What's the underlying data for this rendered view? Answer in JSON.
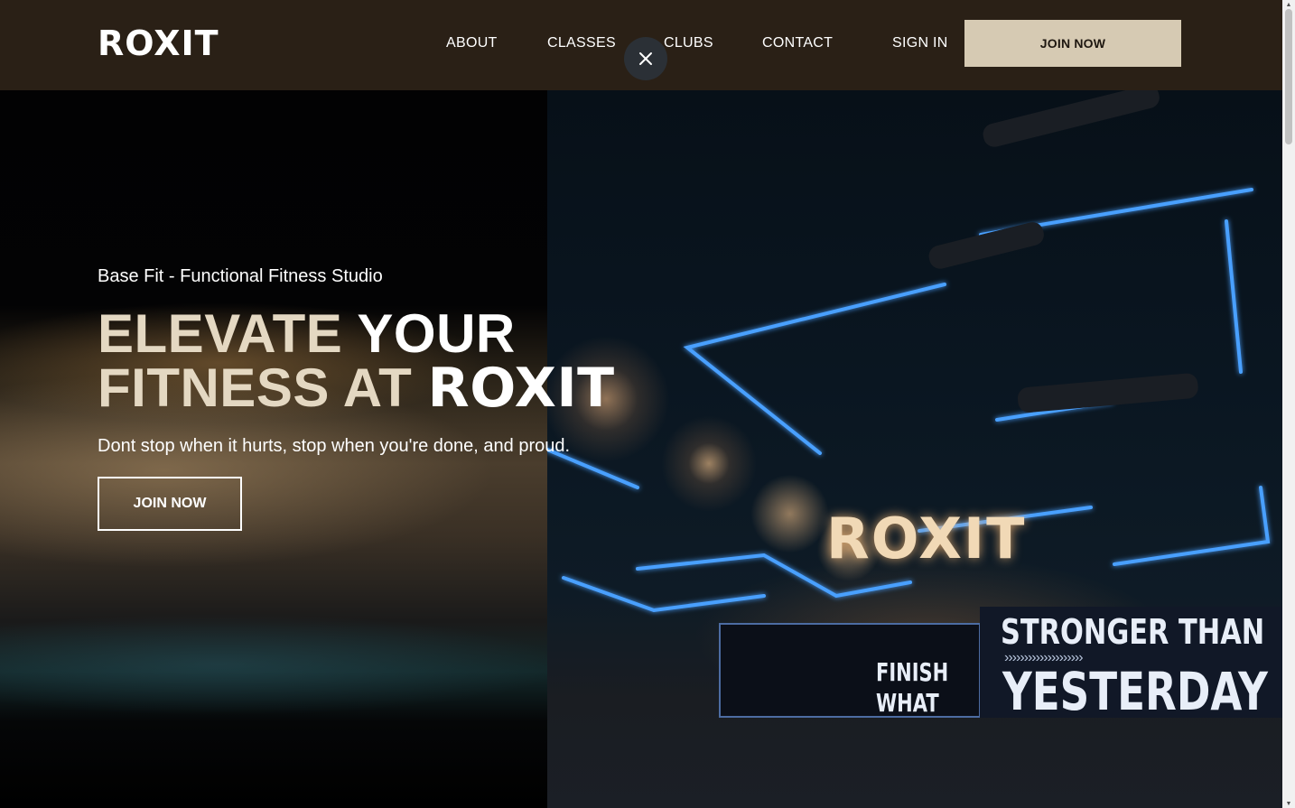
{
  "header": {
    "logo": "ROXIT",
    "nav": {
      "about": "ABOUT",
      "classes": "CLASSES",
      "clubs": "CLUBS",
      "contact": "CONTACT",
      "sign_in": "SIGN IN",
      "join_now": "JOIN NOW"
    },
    "close_icon": "close-icon"
  },
  "hero": {
    "eyebrow": "Base Fit - Functional Fitness Studio",
    "headline_line1_beige": "ELEVATE",
    "headline_line1_white": "YOUR",
    "headline_line2_beige": "FITNESS AT",
    "headline_line2_white": "ROXIT",
    "tagline": "Dont stop when it hurts, stop when you're done, and proud.",
    "cta": "JOIN NOW"
  },
  "photo_signage": {
    "brand": "ROXIT",
    "stronger": "STRONGER THAN",
    "chevrons": "››››››››››››››››››››",
    "yesterday": "YESTERDAY",
    "finish_line1": "FINISH",
    "finish_line2": "WHAT"
  },
  "colors": {
    "header_bg": "#2a2016",
    "accent": "#d6cab3",
    "headline_beige": "#e4d8c2",
    "neon_blue": "#3a8cff"
  }
}
